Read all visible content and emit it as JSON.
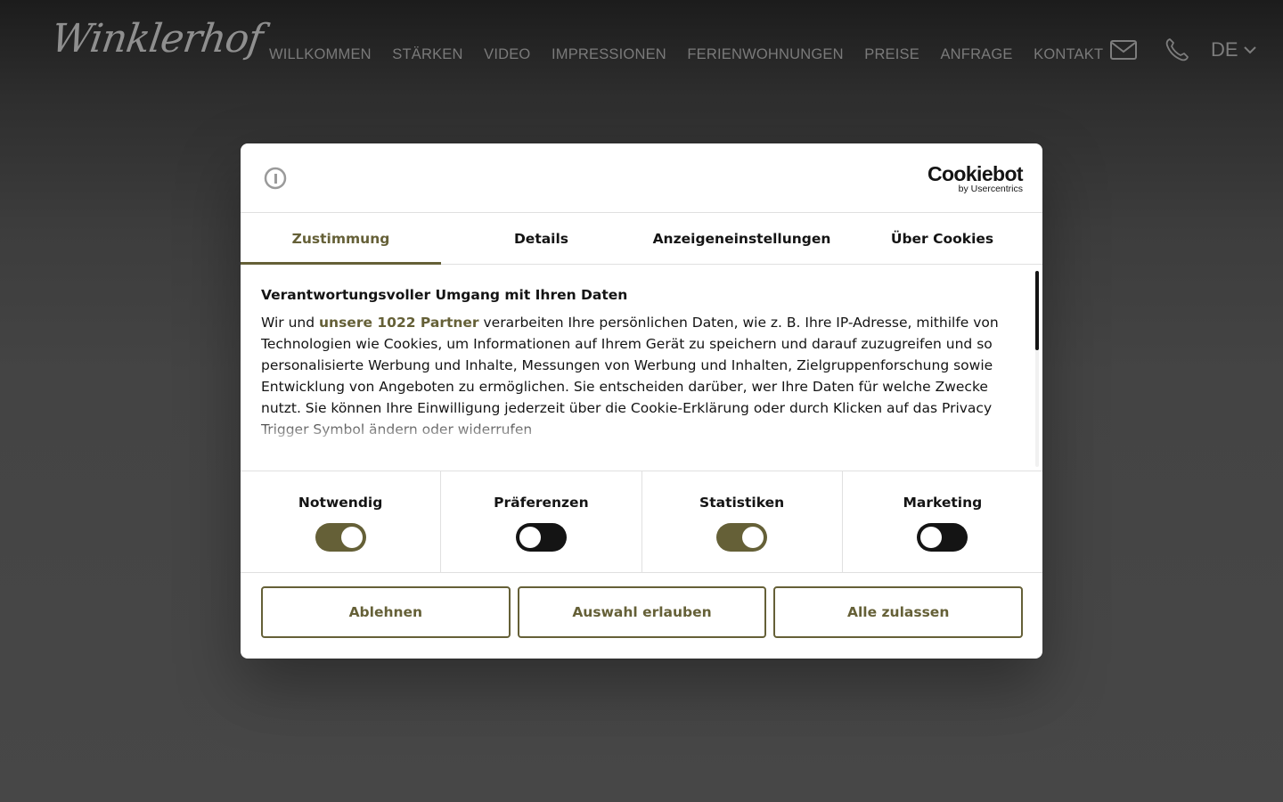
{
  "site": {
    "logo_text": "Winklerhof",
    "nav": [
      "WILLKOMMEN",
      "STÄRKEN",
      "VIDEO",
      "IMPRESSIONEN",
      "FERIENWOHNUNGEN",
      "PREISE",
      "ANFRAGE",
      "KONTAKT"
    ],
    "language": "DE",
    "icons": [
      "mail-icon",
      "phone-icon",
      "chevron-down-icon"
    ]
  },
  "cookie_dialog": {
    "brand": "Cookiebot",
    "brand_sub": "by Usercentrics",
    "tabs": [
      "Zustimmung",
      "Details",
      "Anzeigeneinstellungen",
      "Über Cookies"
    ],
    "active_tab": "Zustimmung",
    "title": "Verantwortungsvoller Umgang mit Ihren Daten",
    "text_before_link": "Wir und ",
    "link_text": "unsere 1022 Partner",
    "text_after_link": " verarbeiten Ihre persönlichen Daten, wie z. B. Ihre IP-Adresse, mithilfe von Technologien wie Cookies, um Informationen auf Ihrem Gerät zu speichern und darauf zuzugreifen und so personalisierte Werbung und Inhalte, Messungen von Werbung und Inhalten, Zielgruppenforschung sowie Entwicklung von Angeboten zu ermöglichen. Sie entscheiden darüber, wer Ihre Daten für welche Zwecke nutzt. Sie können Ihre Einwilligung jederzeit über die Cookie-Erklärung oder durch Klicken auf das Privacy Trigger Symbol ändern oder widerrufen",
    "toggles": [
      {
        "label": "Notwendig",
        "on": true
      },
      {
        "label": "Präferenzen",
        "on": false
      },
      {
        "label": "Statistiken",
        "on": true
      },
      {
        "label": "Marketing",
        "on": false
      }
    ],
    "buttons": {
      "reject": "Ablehnen",
      "allow_selection": "Auswahl erlauben",
      "allow_all": "Alle zulassen"
    }
  },
  "colors": {
    "accent": "#656037",
    "toggle_off": "#141414",
    "overlay_bg": "#454545"
  }
}
